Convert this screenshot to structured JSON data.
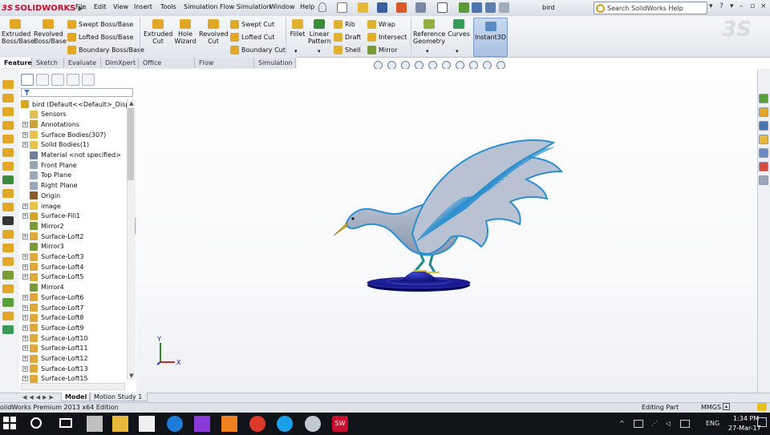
{
  "app": {
    "logo_prefix": "3S",
    "logo_text": "SOLIDWORKS",
    "document_title": "bird"
  },
  "menu": [
    "File",
    "Edit",
    "View",
    "Insert",
    "Tools",
    "Simulation",
    "Flow Simulation",
    "Window",
    "Help"
  ],
  "search": {
    "placeholder": "Search SolidWorks Help"
  },
  "command_manager": {
    "extruded_boss": "Extruded\nBoss/Base",
    "revolved_boss": "Revolved\nBoss/Base",
    "swept_boss": "Swept Boss/Base",
    "lofted_boss": "Lofted Boss/Base",
    "boundary_boss": "Boundary Boss/Base",
    "extruded_cut": "Extruded\nCut",
    "hole_wizard": "Hole\nWizard",
    "revolved_cut": "Revolved\nCut",
    "swept_cut": "Swept Cut",
    "lofted_cut": "Lofted Cut",
    "boundary_cut": "Boundary Cut",
    "fillet": "Fillet",
    "linear_pattern": "Linear\nPattern",
    "rib": "Rib",
    "draft": "Draft",
    "shell": "Shell",
    "wrap": "Wrap",
    "intersect": "Intersect",
    "mirror": "Mirror",
    "reference_geometry": "Reference\nGeometry",
    "curves": "Curves",
    "instant3d": "Instant3D"
  },
  "tabs": [
    "Features",
    "Sketch",
    "Evaluate",
    "DimXpert",
    "Office Products",
    "Flow Simulation",
    "Simulation"
  ],
  "active_tab": "Features",
  "tree": [
    {
      "label": "bird  (Default<<Default>_Displ",
      "expand": false,
      "icon": "part-icon",
      "color": "#d9a520",
      "indent": 0
    },
    {
      "label": "Sensors",
      "expand": false,
      "icon": "sensor-icon",
      "color": "#e0c050",
      "indent": 1
    },
    {
      "label": "Annotations",
      "expand": true,
      "icon": "annotation-icon",
      "color": "#c9a23a",
      "indent": 1
    },
    {
      "label": "Surface Bodies(307)",
      "expand": true,
      "icon": "folder-icon",
      "color": "#e6c34a",
      "indent": 1
    },
    {
      "label": "Solid Bodies(1)",
      "expand": true,
      "icon": "folder-icon",
      "color": "#e6c34a",
      "indent": 1
    },
    {
      "label": "Material <not specified>",
      "expand": false,
      "icon": "material-icon",
      "color": "#6d7f9a",
      "indent": 1
    },
    {
      "label": "Front Plane",
      "expand": false,
      "icon": "plane-icon",
      "color": "#9aa7b8",
      "indent": 1
    },
    {
      "label": "Top Plane",
      "expand": false,
      "icon": "plane-icon",
      "color": "#9aa7b8",
      "indent": 1
    },
    {
      "label": "Right Plane",
      "expand": false,
      "icon": "plane-icon",
      "color": "#9aa7b8",
      "indent": 1
    },
    {
      "label": "Origin",
      "expand": false,
      "icon": "origin-icon",
      "color": "#8b5a2b",
      "indent": 1
    },
    {
      "label": "image",
      "expand": true,
      "icon": "folder-icon",
      "color": "#e6c34a",
      "indent": 1
    },
    {
      "label": "Surface-Fill1",
      "expand": true,
      "icon": "surface-fill-icon",
      "color": "#d4a72c",
      "indent": 1
    },
    {
      "label": "Mirror2",
      "expand": false,
      "icon": "mirror-icon",
      "color": "#7a9a3a",
      "indent": 1
    },
    {
      "label": "Surface-Loft2",
      "expand": true,
      "icon": "surface-loft-icon",
      "color": "#e0a83a",
      "indent": 1
    },
    {
      "label": "Mirror3",
      "expand": false,
      "icon": "mirror-icon",
      "color": "#7a9a3a",
      "indent": 1
    },
    {
      "label": "Surface-Loft3",
      "expand": true,
      "icon": "surface-loft-icon",
      "color": "#e0a83a",
      "indent": 1
    },
    {
      "label": "Surface-Loft4",
      "expand": true,
      "icon": "surface-loft-icon",
      "color": "#e0a83a",
      "indent": 1
    },
    {
      "label": "Surface-Loft5",
      "expand": true,
      "icon": "surface-loft-icon",
      "color": "#e0a83a",
      "indent": 1
    },
    {
      "label": "Mirror4",
      "expand": false,
      "icon": "mirror-icon",
      "color": "#7a9a3a",
      "indent": 1
    },
    {
      "label": "Surface-Loft6",
      "expand": true,
      "icon": "surface-loft-icon",
      "color": "#e0a83a",
      "indent": 1
    },
    {
      "label": "Surface-Loft7",
      "expand": true,
      "icon": "surface-loft-icon",
      "color": "#e0a83a",
      "indent": 1
    },
    {
      "label": "Surface-Loft8",
      "expand": true,
      "icon": "surface-loft-icon",
      "color": "#e0a83a",
      "indent": 1
    },
    {
      "label": "Surface-Loft9",
      "expand": true,
      "icon": "surface-loft-icon",
      "color": "#e0a83a",
      "indent": 1
    },
    {
      "label": "Surface-Loft10",
      "expand": true,
      "icon": "surface-loft-icon",
      "color": "#e0a83a",
      "indent": 1
    },
    {
      "label": "Surface-Loft11",
      "expand": true,
      "icon": "surface-loft-icon",
      "color": "#e0a83a",
      "indent": 1
    },
    {
      "label": "Surface-Loft12",
      "expand": true,
      "icon": "surface-loft-icon",
      "color": "#e0a83a",
      "indent": 1
    },
    {
      "label": "Surface-Loft13",
      "expand": true,
      "icon": "surface-loft-icon",
      "color": "#e0a83a",
      "indent": 1
    },
    {
      "label": "Surface-Loft15",
      "expand": true,
      "icon": "surface-loft-icon",
      "color": "#e0a83a",
      "indent": 1
    }
  ],
  "bottom_tabs": [
    "Model",
    "Motion Study 1"
  ],
  "active_bottom_tab": "Model",
  "status": {
    "edition": "olidWorks Premium 2013 x64 Edition",
    "mode": "Editing Part",
    "units": "MMGS"
  },
  "taskbar": {
    "language": "ENG",
    "time": "1:34 PM",
    "date": "27-Mar-17"
  },
  "triad": {
    "y_label": "Y",
    "x_label": "X"
  },
  "colors": {
    "accent": "#c8102e",
    "model_blue": "#2b8fd0",
    "model_body": "#a9b4c6",
    "base": "#14148a"
  }
}
